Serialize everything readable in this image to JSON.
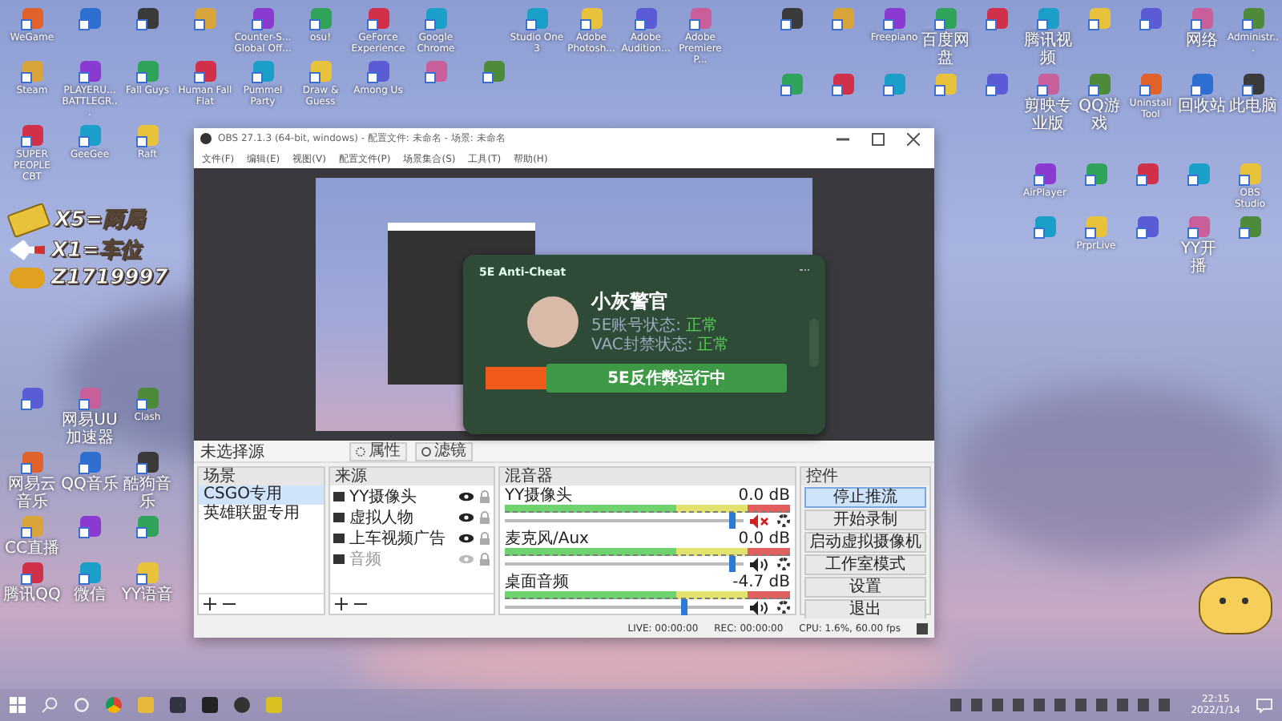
{
  "desktop": {
    "icon_groups": [
      {
        "rows": [
          [
            {
              "label": "WeGame"
            },
            {},
            {},
            {},
            {
              "label": "Counter-S... Global Off..."
            },
            {
              "label": "osu!"
            },
            {
              "label": "GeForce Experience"
            },
            {
              "label": "Google Chrome"
            }
          ],
          [
            {
              "label": "Steam"
            },
            {
              "label": "PLAYERU... BATTLEGR..."
            },
            {
              "label": "Fall Guys"
            },
            {
              "label": "Human Fall Flat"
            },
            {
              "label": "Pummel Party"
            },
            {
              "label": "Draw & Guess"
            },
            {
              "label": "Among Us"
            },
            {},
            {}
          ],
          [
            {
              "label": "SUPER PEOPLE CBT"
            },
            {
              "label": "GeeGee"
            },
            {
              "label": "Raft"
            }
          ]
        ]
      },
      {
        "rows": [
          [
            {
              "label": "Studio One 3"
            },
            {
              "label": "Adobe Photosh..."
            },
            {
              "label": "Adobe Audition..."
            },
            {
              "label": "Adobe Premiere P..."
            }
          ]
        ]
      },
      {
        "rows": [
          [
            {},
            {},
            {
              "label": "Freepiano"
            },
            {
              "label": "百度网盘"
            },
            {},
            {
              "label": "腾讯视频"
            },
            {},
            {},
            {
              "label": "网络"
            },
            {
              "label": "Administr..."
            }
          ],
          [
            {},
            {},
            {},
            {},
            {},
            {
              "label": "剪映专业版"
            },
            {
              "label": "QQ游戏"
            },
            {
              "label": "Uninstall Tool"
            },
            {
              "label": "回收站"
            },
            {
              "label": "此电脑"
            }
          ]
        ]
      },
      {
        "rows": [
          [
            {},
            {
              "label": "网易UU加速器"
            },
            {
              "label": "Clash"
            }
          ],
          [
            {
              "label": "网易云音乐"
            },
            {
              "label": "QQ音乐"
            },
            {
              "label": "酷狗音乐"
            }
          ],
          [
            {
              "label": "CC直播"
            },
            {},
            {}
          ],
          [
            {
              "label": "腾讯QQ"
            },
            {
              "label": "微信"
            },
            {
              "label": "YY语音"
            }
          ]
        ]
      },
      {
        "rows": [
          [
            {
              "label": "AirPlayer"
            },
            {},
            {},
            {},
            {
              "label": "OBS Studio"
            }
          ],
          [
            {},
            {
              "label": "PrprLive"
            },
            {},
            {
              "label": "YY开播"
            },
            {}
          ]
        ]
      }
    ],
    "overlay_lines": [
      "X5=两局",
      "X1=车位",
      "Z1719997"
    ]
  },
  "obs_window": {
    "title": "OBS 27.1.3 (64-bit, windows) - 配置文件: 未命名 - 场景: 未命名",
    "menu": [
      "文件(F)",
      "编辑(E)",
      "视图(V)",
      "配置文件(P)",
      "场景集合(S)",
      "工具(T)",
      "帮助(H)"
    ],
    "popup": {
      "title": "5E Anti-Cheat",
      "user": "小灰警官",
      "status_lines": [
        {
          "label": "5E账号状态:",
          "value": "正常"
        },
        {
          "label": "VAC封禁状态:",
          "value": "正常"
        }
      ],
      "status_button": "5E反作弊运行中"
    },
    "source_toolbar": {
      "label": "未选择源",
      "buttons": [
        "属性",
        "滤镜"
      ]
    },
    "scenes": {
      "title": "场景",
      "items": [
        {
          "label": "CSGO专用",
          "selected": true
        },
        {
          "label": "英雄联盟专用",
          "selected": false
        }
      ]
    },
    "sources": {
      "title": "来源",
      "items": [
        {
          "label": "YY摄像头",
          "visible": true
        },
        {
          "label": "虚拟人物",
          "visible": true
        },
        {
          "label": "上车视频广告",
          "visible": true
        },
        {
          "label": "音频",
          "visible": false
        }
      ]
    },
    "mixer": {
      "title": "混音器",
      "channels": [
        {
          "name": "YY摄像头",
          "reading": "0.0 dB",
          "level": 0.95,
          "muted": true
        },
        {
          "name": "麦克风/Aux",
          "reading": "0.0 dB",
          "level": 0.95,
          "muted": false
        },
        {
          "name": "桌面音频",
          "reading": "-4.7 dB",
          "level": 0.75,
          "muted": false
        }
      ]
    },
    "controls": {
      "title": "控件",
      "buttons": [
        {
          "label": "停止推流",
          "selected": true
        },
        {
          "label": "开始录制",
          "selected": false
        },
        {
          "label": "启动虚拟摄像机",
          "selected": false
        },
        {
          "label": "工作室模式",
          "selected": false
        },
        {
          "label": "设置",
          "selected": false
        },
        {
          "label": "退出",
          "selected": false
        }
      ]
    },
    "status_bar": [
      "LIVE: 00:00:00",
      "REC: 00:00:00",
      "CPU: 1.6%, 60.00 fps"
    ]
  },
  "taskbar": {
    "time": "22:15",
    "date": "2022/1/14"
  }
}
